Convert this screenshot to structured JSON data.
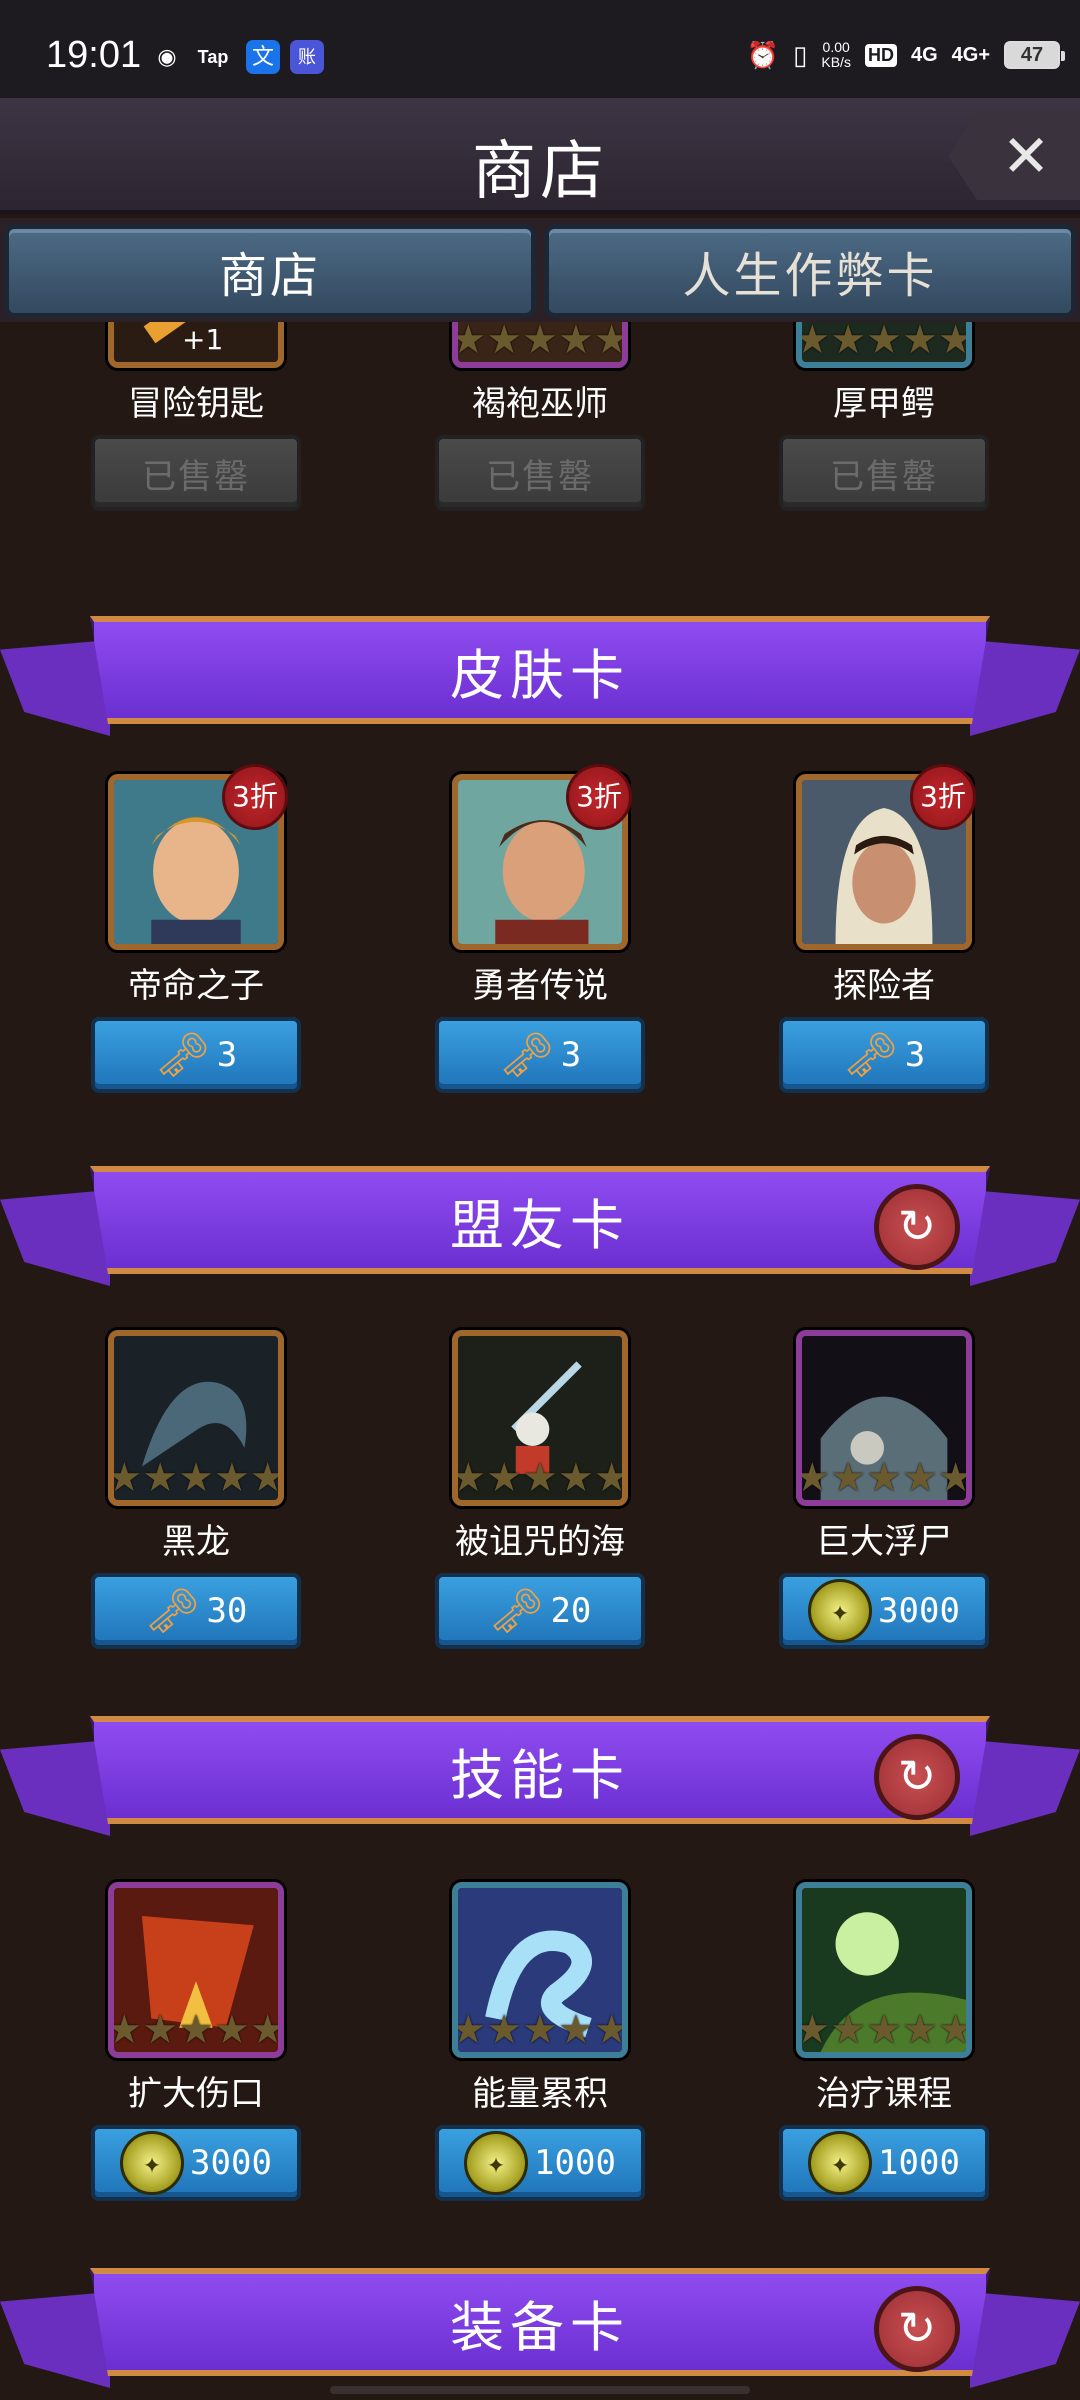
{
  "status_bar": {
    "time": "19:01",
    "net_speed_value": "0.00",
    "net_speed_unit": "KB/s",
    "hd_label": "HD",
    "signal_1": "4G",
    "signal_2": "4G+",
    "battery": "47",
    "apps": [
      "Tap",
      "文",
      "账"
    ]
  },
  "header": {
    "title": "商店",
    "close_icon": "✕"
  },
  "tabs": [
    {
      "label": "商店",
      "active": true
    },
    {
      "label": "人生作弊卡",
      "active": false
    }
  ],
  "top_items": [
    {
      "name": "冒险钥匙",
      "overlay": "+1",
      "status": "已售罄"
    },
    {
      "name": "褐袍巫师",
      "status": "已售罄"
    },
    {
      "name": "厚甲鳄",
      "status": "已售罄"
    }
  ],
  "sections": {
    "skin": {
      "title": "皮肤卡",
      "items": [
        {
          "name": "帝命之子",
          "badge": "3折",
          "price": "3",
          "currency": "key-icon"
        },
        {
          "name": "勇者传说",
          "badge": "3折",
          "price": "3",
          "currency": "key-icon"
        },
        {
          "name": "探险者",
          "badge": "3折",
          "price": "3",
          "currency": "key-icon"
        }
      ]
    },
    "ally": {
      "title": "盟友卡",
      "items": [
        {
          "name": "黑龙",
          "price": "30",
          "currency": "key-icon"
        },
        {
          "name": "被诅咒的海",
          "price": "20",
          "currency": "key-icon"
        },
        {
          "name": "巨大浮尸",
          "price": "3000",
          "currency": "coin-icon"
        }
      ]
    },
    "skill": {
      "title": "技能卡",
      "items": [
        {
          "name": "扩大伤口",
          "price": "3000",
          "currency": "coin-icon"
        },
        {
          "name": "能量累积",
          "price": "1000",
          "currency": "coin-icon"
        },
        {
          "name": "治疗课程",
          "price": "1000",
          "currency": "coin-icon"
        }
      ]
    },
    "equip": {
      "title": "装备卡"
    }
  },
  "colors": {
    "background": "#241814",
    "ribbon": "#7a3ce0",
    "price_button": "#2a8ad0",
    "badge": "#b3202a"
  }
}
